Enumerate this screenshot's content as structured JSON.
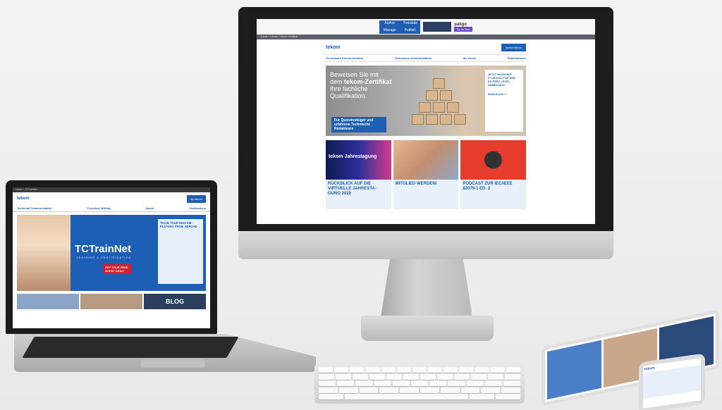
{
  "imac": {
    "ad": {
      "grid": [
        "Author",
        "Translate",
        "Manage",
        "Publish"
      ],
      "brand": "paligo",
      "cta": "Try for free"
    },
    "breadcrumb": "Home > Library > tekom Zertifikat",
    "site": {
      "logo": "tekom",
      "cta_button": "meine tekom",
      "nav": [
        "Technische Kommunikation",
        "Technische Kommunikation",
        "die tekom",
        "Publikationen"
      ],
      "hero": {
        "line1": "Beweisen Sie mit",
        "line2_prefix": "dem ",
        "line2_bold": "tekom-Zertifikat",
        "line3": "Ihre fachliche",
        "line4": "Qualifikation.",
        "badge": "Für Quereinsteiger und erfahrene Technische Redakteure",
        "card_title": "JETZT NOCH BIS 07.05.2021 FÜR DEN EX-PERT LEVEL ANMELDEN!",
        "card_link": "Weiterlesen >"
      },
      "tiles": [
        {
          "title": "RÜCKBLICK AUF DIE VIRTUELLE JAHRESTA-GUNG 2020",
          "text": "",
          "video_label": "tekom Jahrestagung"
        },
        {
          "title": "MITGLIED WERDEN!",
          "text": ""
        },
        {
          "title": "PODCAST ZUR IEC/IEEE 82079-1 ED. 2",
          "text": ""
        }
      ]
    }
  },
  "laptop": {
    "breadcrumb": "Home > TCTrainNet",
    "logo": "tekom",
    "cta_button": "my tekom",
    "nav": [
      "Technical Communication",
      "Technical Writing",
      "tekom",
      "Publications"
    ],
    "brand": "TCTrainNet",
    "brand_sub": "TRAINING & CERTIFICATION",
    "promo": "GET YOUR FREE GUEST DEAL!",
    "card_title": "TRAIN YOUR NEW EM-PLOYEES FROM ABROAD",
    "blog_label": "BLOG"
  },
  "colors": {
    "accent": "#1d5fb5",
    "promo_red": "#d21f2b"
  }
}
